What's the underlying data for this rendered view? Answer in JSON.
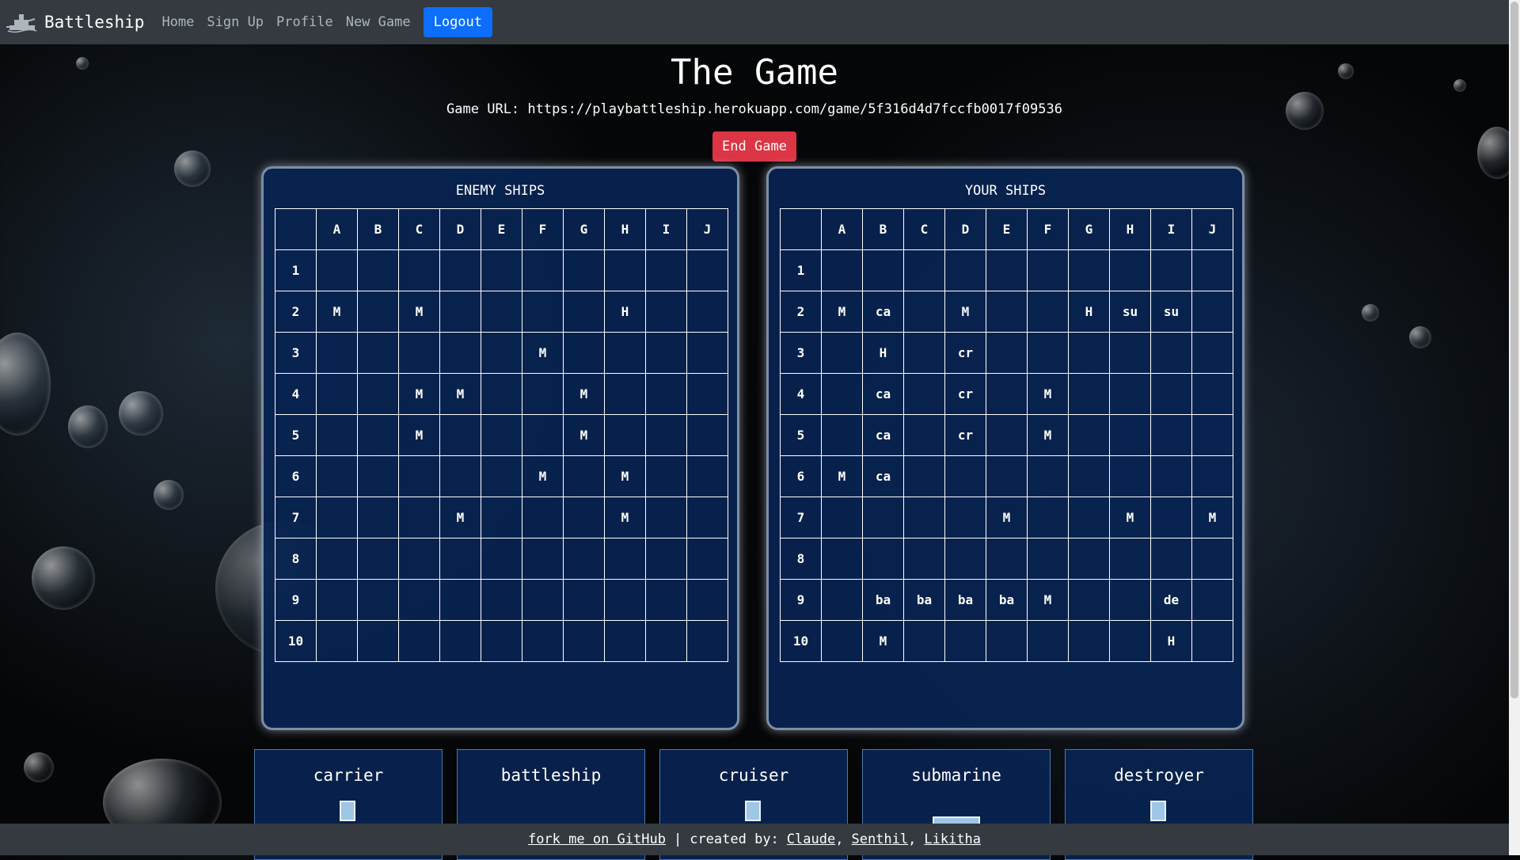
{
  "nav": {
    "brand": "Battleship",
    "links": [
      "Home",
      "Sign Up",
      "Profile",
      "New Game"
    ],
    "logout_label": "Logout"
  },
  "main": {
    "title": "The Game",
    "game_url_label": "Game URL:",
    "game_url": "https://playbattleship.herokuapp.com/game/5f316d4d7fccfb0017f09536",
    "end_game_label": "End Game"
  },
  "columns": [
    "A",
    "B",
    "C",
    "D",
    "E",
    "F",
    "G",
    "H",
    "I",
    "J"
  ],
  "rows": [
    "1",
    "2",
    "3",
    "4",
    "5",
    "6",
    "7",
    "8",
    "9",
    "10"
  ],
  "enemy_board": {
    "title": "ENEMY SHIPS",
    "cells": [
      [
        "",
        "",
        "",
        "",
        "",
        "",
        "",
        "",
        "",
        ""
      ],
      [
        "M",
        "",
        "M",
        "",
        "",
        "",
        "",
        "H",
        "",
        ""
      ],
      [
        "",
        "",
        "",
        "",
        "",
        "M",
        "",
        "",
        "",
        ""
      ],
      [
        "",
        "",
        "M",
        "M",
        "",
        "",
        "M",
        "",
        "",
        ""
      ],
      [
        "",
        "",
        "M",
        "",
        "",
        "",
        "M",
        "",
        "",
        ""
      ],
      [
        "",
        "",
        "",
        "",
        "",
        "M",
        "",
        "M",
        "",
        ""
      ],
      [
        "",
        "",
        "",
        "M",
        "",
        "",
        "",
        "M",
        "",
        ""
      ],
      [
        "",
        "",
        "",
        "",
        "",
        "",
        "",
        "",
        "",
        ""
      ],
      [
        "",
        "",
        "",
        "",
        "",
        "",
        "",
        "",
        "",
        ""
      ],
      [
        "",
        "",
        "",
        "",
        "",
        "",
        "",
        "",
        "",
        ""
      ]
    ]
  },
  "your_board": {
    "title": "YOUR SHIPS",
    "cells": [
      [
        "",
        "",
        "",
        "",
        "",
        "",
        "",
        "",
        "",
        ""
      ],
      [
        "M",
        "ca",
        "",
        "M",
        "",
        "",
        "H",
        "su",
        "su",
        ""
      ],
      [
        "",
        "H",
        "",
        "cr",
        "",
        "",
        "",
        "",
        "",
        ""
      ],
      [
        "",
        "ca",
        "",
        "cr",
        "",
        "M",
        "",
        "",
        "",
        ""
      ],
      [
        "",
        "ca",
        "",
        "cr",
        "",
        "M",
        "",
        "",
        "",
        ""
      ],
      [
        "M",
        "ca",
        "",
        "",
        "",
        "",
        "",
        "",
        "",
        ""
      ],
      [
        "",
        "",
        "",
        "",
        "M",
        "",
        "",
        "M",
        "",
        "M"
      ],
      [
        "",
        "",
        "",
        "",
        "",
        "",
        "",
        "",
        "",
        ""
      ],
      [
        "",
        "ba",
        "ba",
        "ba",
        "ba",
        "M",
        "",
        "",
        "de",
        ""
      ],
      [
        "",
        "M",
        "",
        "",
        "",
        "",
        "",
        "",
        "H",
        ""
      ]
    ]
  },
  "ships": [
    {
      "name": "carrier",
      "icon": "ship-vertical-icon"
    },
    {
      "name": "battleship",
      "icon": ""
    },
    {
      "name": "cruiser",
      "icon": "ship-vertical-icon"
    },
    {
      "name": "submarine",
      "icon": "ship-horizontal-icon"
    },
    {
      "name": "destroyer",
      "icon": "ship-vertical-icon"
    }
  ],
  "footer": {
    "fork_link": "fork me on GitHub",
    "separator": "|",
    "created_by": "created by:",
    "authors": [
      "Claude",
      "Senthil",
      "Likitha"
    ],
    "comma": ","
  },
  "colors": {
    "navbar": "#343a40",
    "logout": "#0d6efd",
    "end_game": "#dc3545",
    "board_bg": "#082352"
  }
}
